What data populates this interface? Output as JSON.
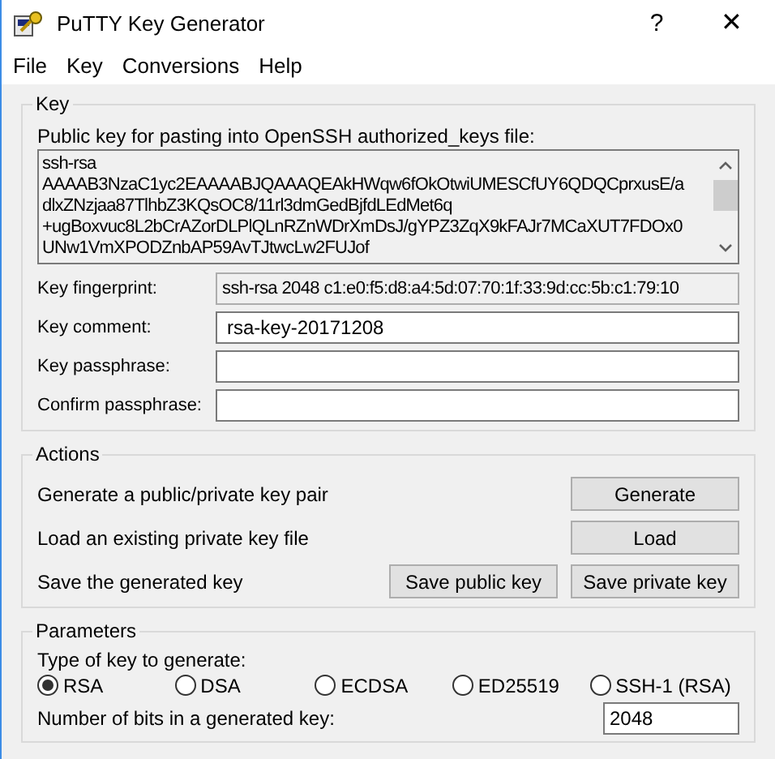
{
  "window": {
    "title": "PuTTY Key Generator",
    "help_button": "?",
    "close_button": "✕"
  },
  "menu": [
    "File",
    "Key",
    "Conversions",
    "Help"
  ],
  "key_group": {
    "title": "Key",
    "public_key_label": "Public key for pasting into OpenSSH authorized_keys file:",
    "public_key_lines": [
      "ssh-rsa",
      "AAAAB3NzaC1yc2EAAAABJQAAAQEAkHWqw6fOkOtwiUMESCfUY6QDQCprxusE/a",
      "dlxZNzjaa87TlhbZ3KQsOC8/11rl3dmGedBjfdLEdMet6q",
      "+ugBoxvuc8L2bCrAZorDLPlQLnRZnWDrXmDsJ/gYPZ3ZqX9kFAJr7MCaXUT7FDOx0",
      "UNw1VmXPODZnbAP59AvTJtwcLw2FUJof"
    ],
    "fields": [
      {
        "label": "Key fingerprint:",
        "value": "ssh-rsa 2048 c1:e0:f5:d8:a4:5d:07:70:1f:33:9d:cc:5b:c1:79:10",
        "readonly": true
      },
      {
        "label": "Key comment:",
        "value": "rsa-key-20171208",
        "readonly": false
      },
      {
        "label": "Key passphrase:",
        "readonly": false
      },
      {
        "label": "Confirm passphrase:",
        "readonly": false
      }
    ]
  },
  "actions_group": {
    "title": "Actions",
    "rows": [
      {
        "label": "Generate a public/private key pair",
        "buttons": [
          "Generate"
        ]
      },
      {
        "label": "Load an existing private key file",
        "buttons": [
          "Load"
        ]
      },
      {
        "label": "Save the generated key",
        "buttons": [
          "Save public key",
          "Save private key"
        ]
      }
    ]
  },
  "parameters_group": {
    "title": "Parameters",
    "type_label": "Type of key to generate:",
    "key_types": [
      {
        "label": "RSA",
        "selected": true
      },
      {
        "label": "DSA",
        "selected": false
      },
      {
        "label": "ECDSA",
        "selected": false
      },
      {
        "label": "ED25519",
        "selected": false
      },
      {
        "label": "SSH-1 (RSA)",
        "selected": false
      }
    ],
    "bits_label": "Number of bits in a generated key:",
    "bits_value": "2048"
  }
}
